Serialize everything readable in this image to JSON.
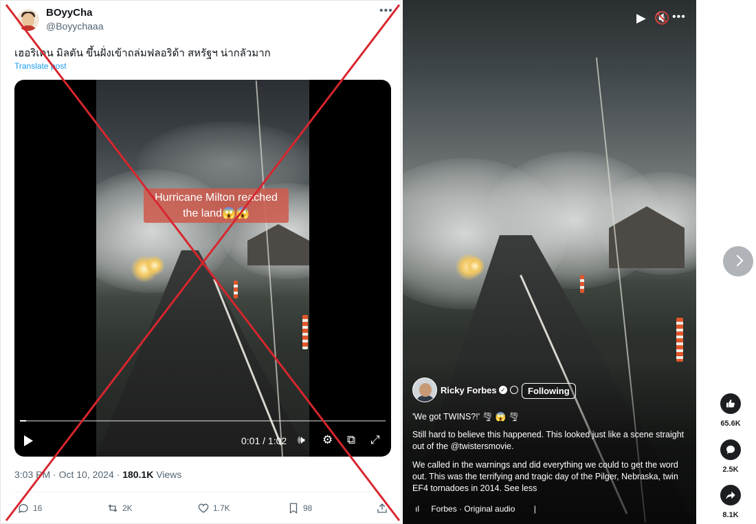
{
  "tweet": {
    "display_name": "BOyyCha",
    "handle": "@Boyychaaa",
    "text": "เฮอริเคน มิลตัน ขึ้นฝั่งเข้าถล่มฟลอริด้า สหรัฐฯ น่ากลัวมาก",
    "translate_label": "Translate post",
    "video": {
      "caption_line1": "Hurricane Milton reached",
      "caption_line2": "the land😱😱",
      "time": "0:01 / 1:02",
      "progress_fraction": 0.016
    },
    "time_label": "3:03 PM · Oct 10, 2024 · ",
    "views_count": "180.1K",
    "views_label": " Views",
    "stats": {
      "replies": "16",
      "reposts": "2K",
      "likes": "1.7K",
      "bookmarks": "98"
    }
  },
  "reel": {
    "author": "Ricky Forbes",
    "follow_label": "Following",
    "title": "'We got TWINS?!' 🌪 😱 🌪",
    "paragraph1": "Still hard to believe this happened. This looked just like a scene straight out of the @twistersmovie.",
    "paragraph2": "We called in the warnings and did everything we could to get the word out. This was the terrifying and tragic day of the Pilger, Nebraska, twin EF4 tornadoes in 2014. See less",
    "audio_label": "Forbes · Original audio",
    "likes": "65.6K",
    "comments": "2.5K",
    "shares": "8.1K"
  },
  "colors": {
    "x_accent": "#1d9bf0",
    "cross_red": "#d7262e",
    "muted": "#536471"
  }
}
